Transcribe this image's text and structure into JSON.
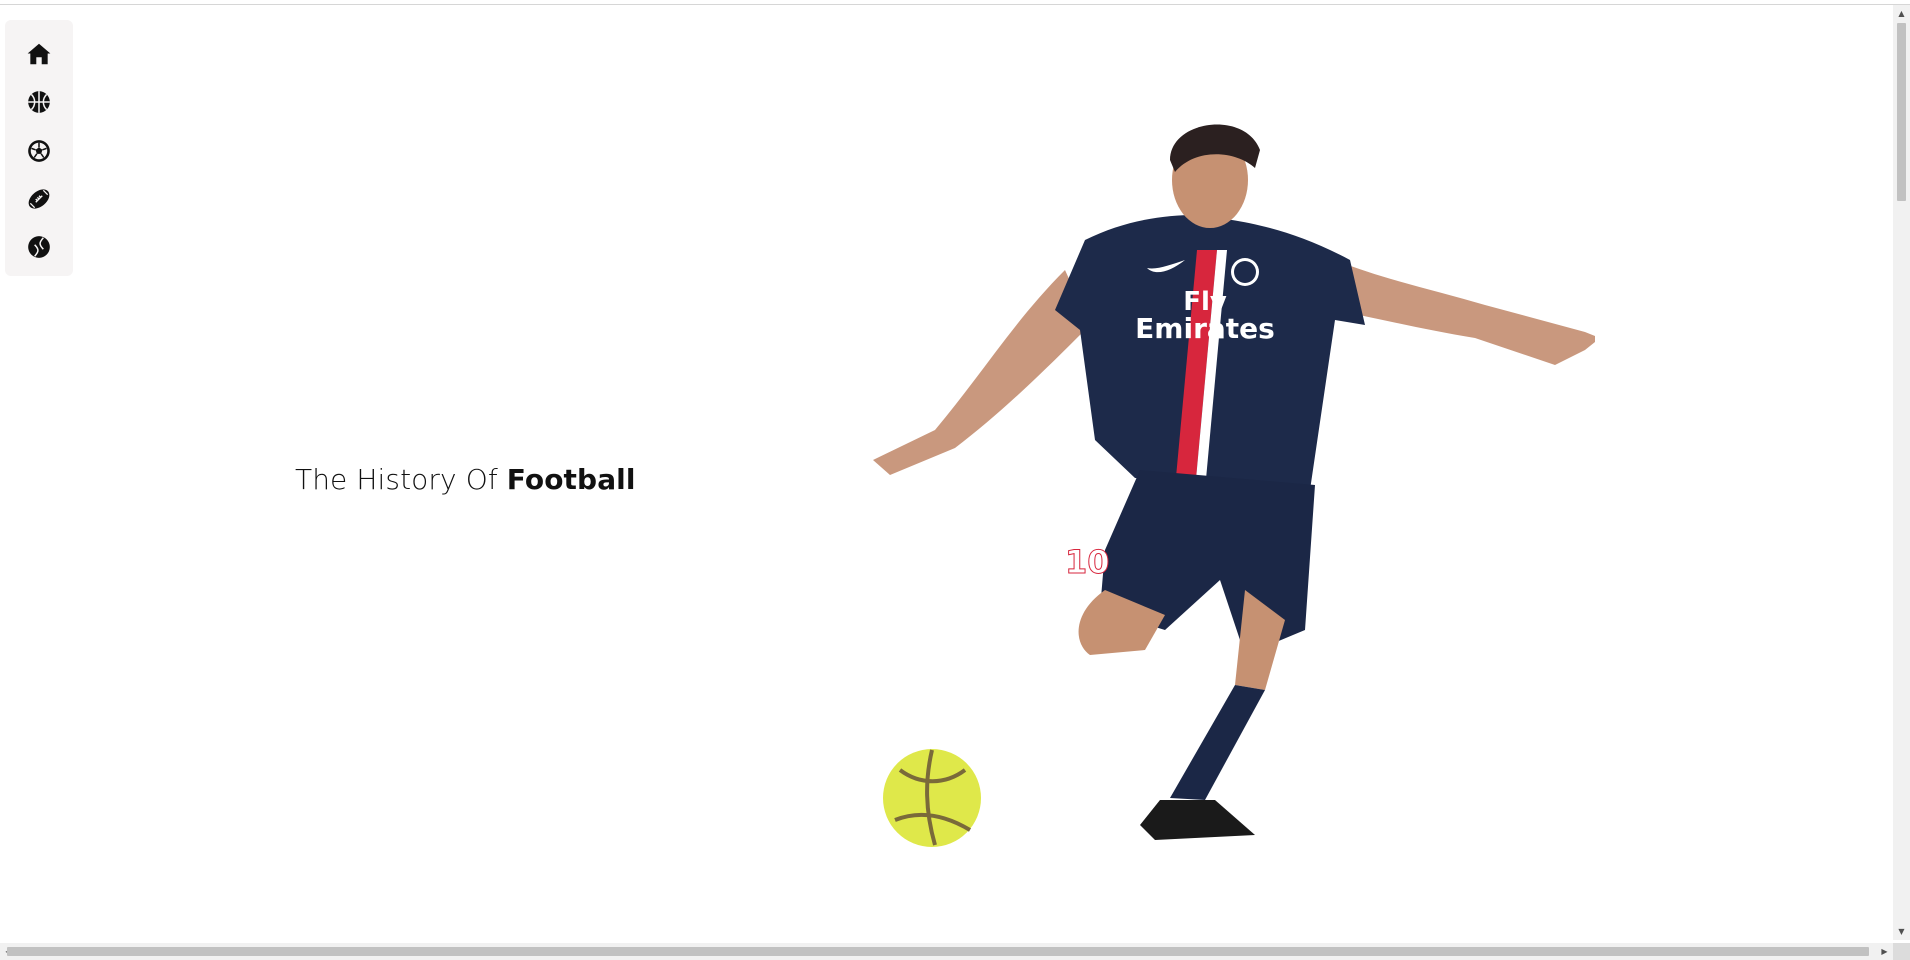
{
  "sidebar": {
    "items": [
      {
        "icon": "home-icon"
      },
      {
        "icon": "basketball-icon"
      },
      {
        "icon": "soccer-ball-icon"
      },
      {
        "icon": "american-football-icon"
      },
      {
        "icon": "baseball-icon"
      }
    ]
  },
  "hero": {
    "title_prefix": "The History Of ",
    "title_strong": "Football"
  },
  "player": {
    "jersey_text_1": "Fly",
    "jersey_text_2": "Emirates",
    "jersey_number": "10"
  },
  "colors": {
    "sidebar_bg": "#f6f4f4",
    "icon": "#111111",
    "kit_navy": "#1d2a4a",
    "kit_red": "#d7263d",
    "ball_yellow": "#dfe84a"
  }
}
